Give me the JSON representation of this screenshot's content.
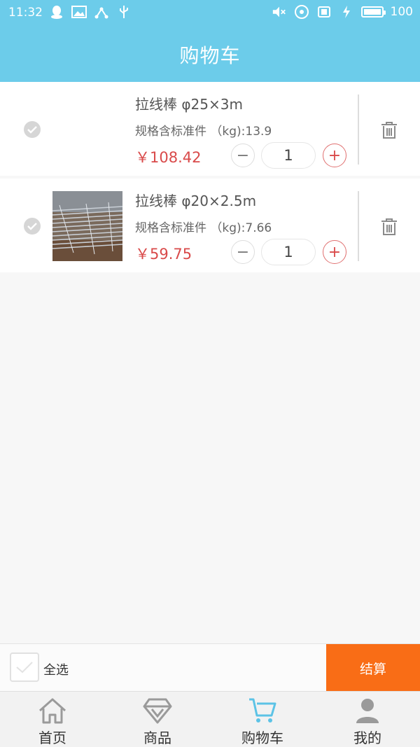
{
  "status_bar": {
    "time": "11:32",
    "battery": "100",
    "battery_level": 1.0,
    "icons_left": [
      "qq-icon",
      "image-icon",
      "share-icon",
      "usb-icon"
    ],
    "icons_right": [
      "mute-icon",
      "nfc-icon",
      "sim-icon",
      "charging-icon",
      "battery-icon"
    ]
  },
  "header": {
    "title": "购物车"
  },
  "cart": {
    "items": [
      {
        "title": "拉线棒 φ25×3m",
        "spec": "规格含标准件 （kg):13.9",
        "price": "￥108.42",
        "quantity": "1",
        "minus": "−",
        "plus": "+",
        "has_image": false,
        "checked": true
      },
      {
        "title": "拉线棒 φ20×2.5m",
        "spec": "规格含标准件 （kg):7.66",
        "price": "￥59.75",
        "quantity": "1",
        "minus": "−",
        "plus": "+",
        "has_image": true,
        "checked": true
      }
    ]
  },
  "checkout_bar": {
    "select_all_label": "全选",
    "checkout_label": "结算",
    "checkout_color": "#f96d16"
  },
  "tabbar": {
    "tabs": [
      {
        "label": "首页",
        "icon": "home-icon"
      },
      {
        "label": "商品",
        "icon": "diamond-icon"
      },
      {
        "label": "购物车",
        "icon": "cart-icon",
        "active": true
      },
      {
        "label": "我的",
        "icon": "user-icon"
      }
    ],
    "active_color": "#5cc3e6",
    "inactive_color": "#9a9a9a"
  },
  "colors": {
    "header_bg": "#6cccea",
    "price": "#d94a4a"
  }
}
